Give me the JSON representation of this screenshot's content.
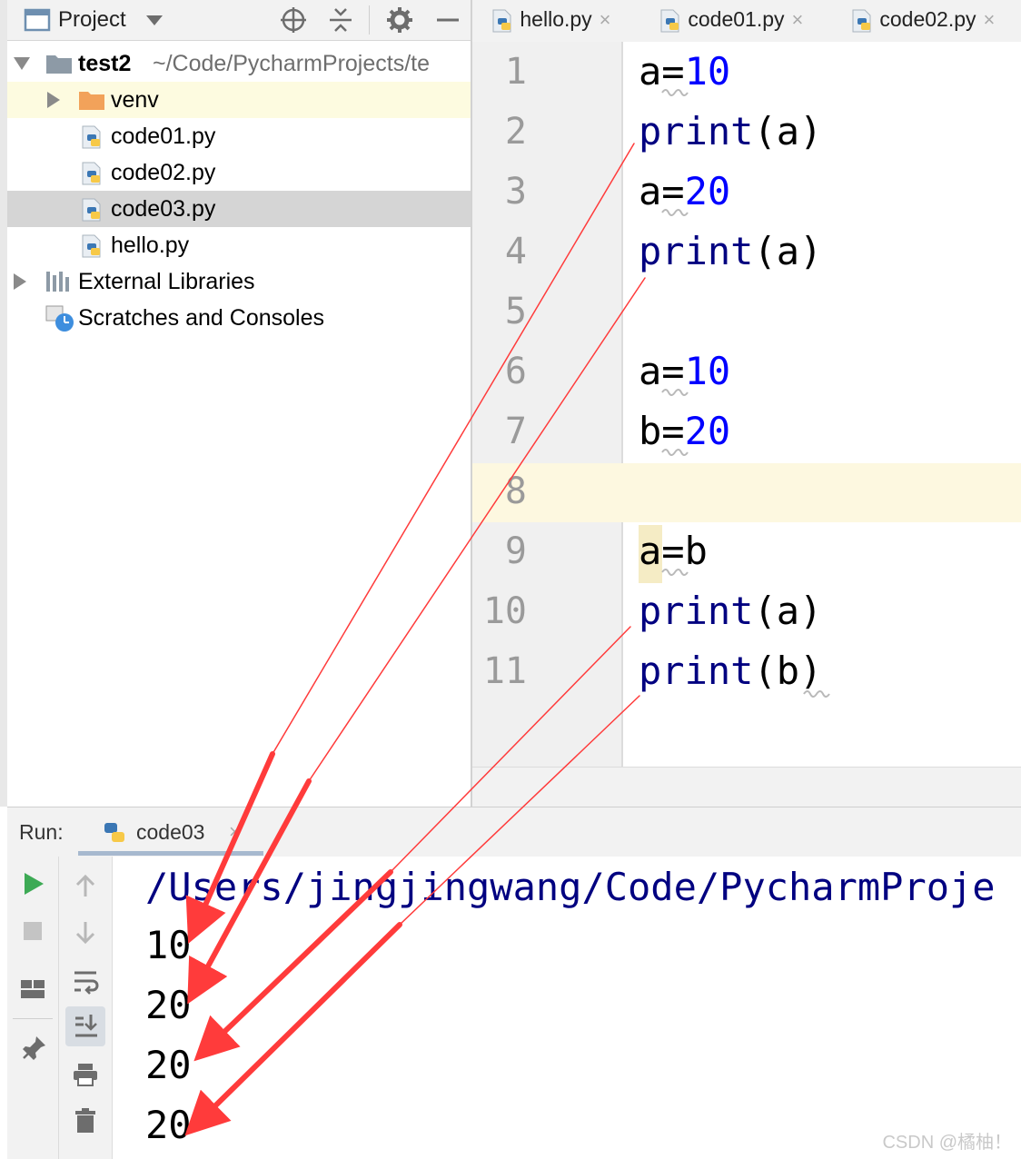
{
  "project_panel": {
    "title": "Project",
    "root_name": "test2",
    "root_path": "~/Code/PycharmProjects/te",
    "items": [
      {
        "label": "venv",
        "kind": "folder"
      },
      {
        "label": "code01.py",
        "kind": "python"
      },
      {
        "label": "code02.py",
        "kind": "python"
      },
      {
        "label": "code03.py",
        "kind": "python",
        "selected": true
      },
      {
        "label": "hello.py",
        "kind": "python"
      }
    ],
    "external_libraries": "External Libraries",
    "scratches": "Scratches and Consoles"
  },
  "editor": {
    "tabs": [
      {
        "label": "hello.py",
        "close": "×"
      },
      {
        "label": "code01.py",
        "close": "×"
      },
      {
        "label": "code02.py",
        "close": "×"
      }
    ],
    "line_numbers": [
      "1",
      "2",
      "3",
      "4",
      "5",
      "6",
      "7",
      "8",
      "9",
      "10",
      "11"
    ],
    "lines": [
      {
        "var": "a=",
        "num": "10"
      },
      {
        "kw": "print",
        "rest": "(a)"
      },
      {
        "var": "a=",
        "num": "20"
      },
      {
        "kw": "print",
        "rest": "(a)"
      },
      {},
      {
        "var": "a=",
        "num": "10"
      },
      {
        "var": "b=",
        "num": "20"
      },
      {},
      {
        "var": "a=b"
      },
      {
        "kw": "print",
        "rest": "(a)"
      },
      {
        "kw": "print",
        "rest": "(b)"
      }
    ]
  },
  "run_panel": {
    "label": "Run:",
    "tab_label": "code03",
    "tab_close": "×",
    "console": {
      "path": "/Users/jingjingwang/Code/PycharmProje",
      "outputs": [
        "10",
        "20",
        "20",
        "20"
      ]
    }
  },
  "watermark": "CSDN @橘柚！",
  "colors": {
    "keyword": "#000080",
    "number": "#0000ff",
    "annotation_arrow": "#ff3b3b",
    "caret_line": "#fdf8e0",
    "selected_row": "#d5d5d5"
  }
}
